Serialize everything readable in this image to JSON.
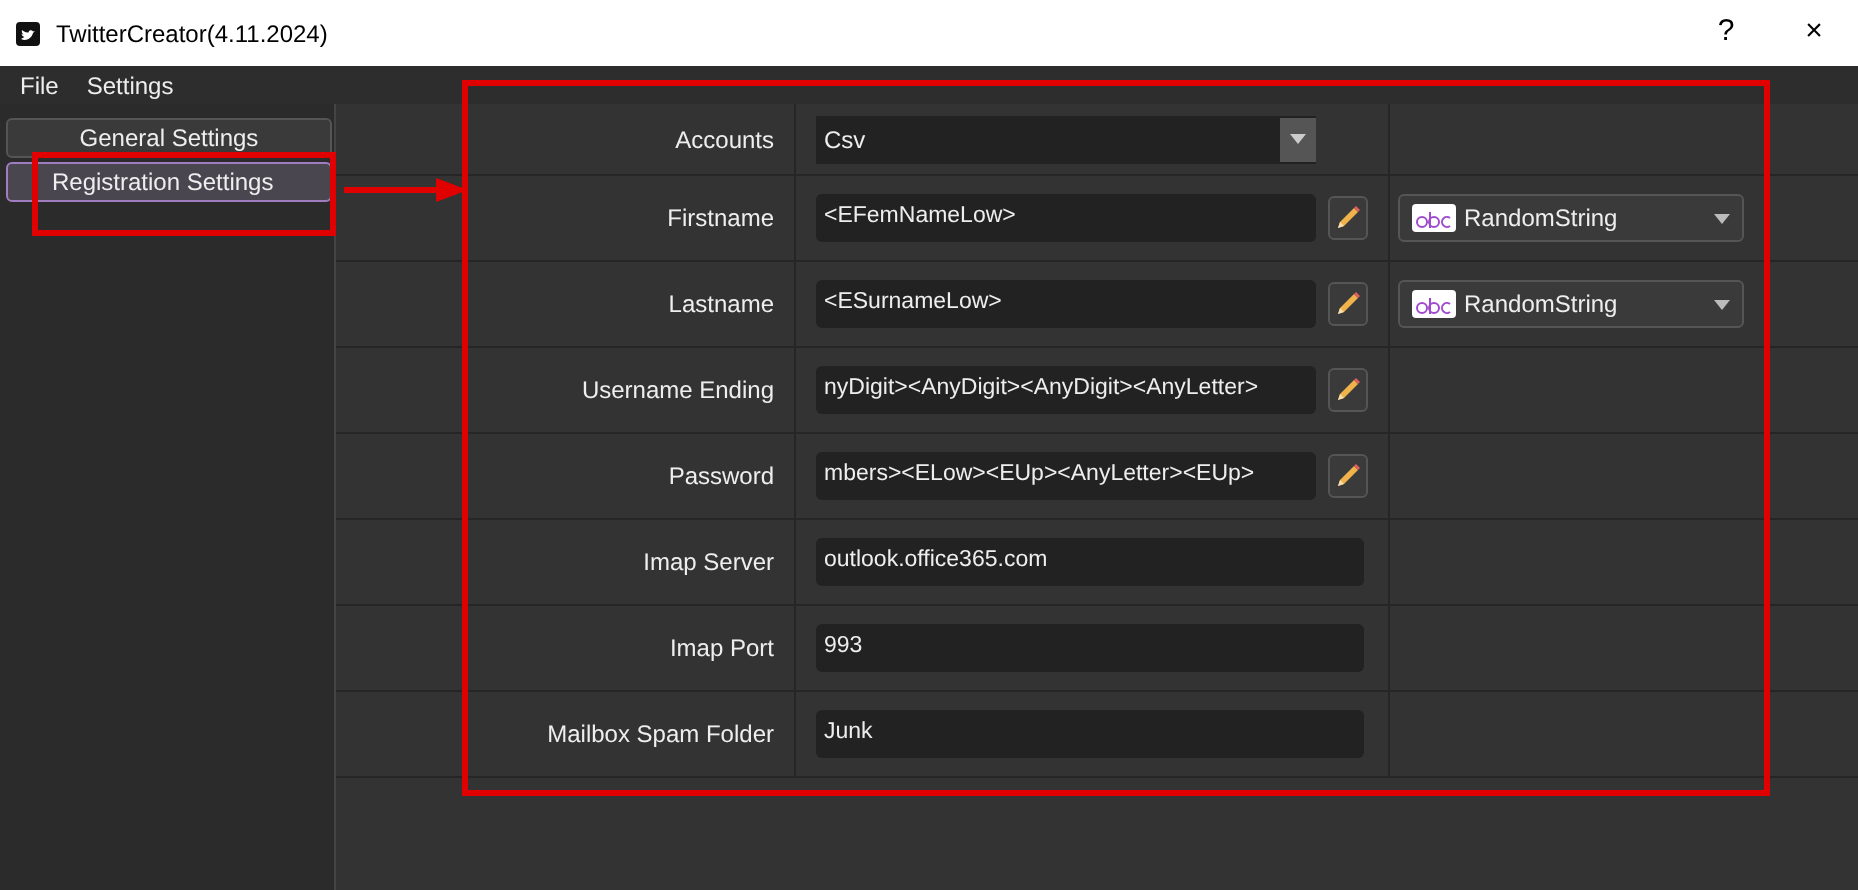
{
  "window": {
    "title": "TwitterCreator(4.11.2024)",
    "buttons": [
      "?",
      "×"
    ]
  },
  "menu": [
    "File",
    "Settings"
  ],
  "sidebar": {
    "items": [
      {
        "label": "General Settings",
        "selected": false
      },
      {
        "label": "Registration Settings",
        "selected": true
      }
    ]
  },
  "form": {
    "rows": [
      {
        "kind": "combo",
        "label": "Accounts",
        "value": "Csv"
      },
      {
        "kind": "edit",
        "label": "Firstname",
        "value": "<EFemNameLow>",
        "generator": "RandomString"
      },
      {
        "kind": "edit",
        "label": "Lastname",
        "value": "<ESurnameLow>",
        "generator": "RandomString"
      },
      {
        "kind": "edit",
        "label": "Username Ending",
        "value": "nyDigit><AnyDigit><AnyDigit><AnyLetter>"
      },
      {
        "kind": "edit",
        "label": "Password",
        "value": "mbers><ELow><EUp><AnyLetter><EUp>"
      },
      {
        "kind": "text",
        "label": "Imap Server",
        "value": "outlook.office365.com"
      },
      {
        "kind": "text",
        "label": "Imap Port",
        "value": "993"
      },
      {
        "kind": "text",
        "label": "Mailbox Spam Folder",
        "value": "Junk"
      }
    ]
  }
}
